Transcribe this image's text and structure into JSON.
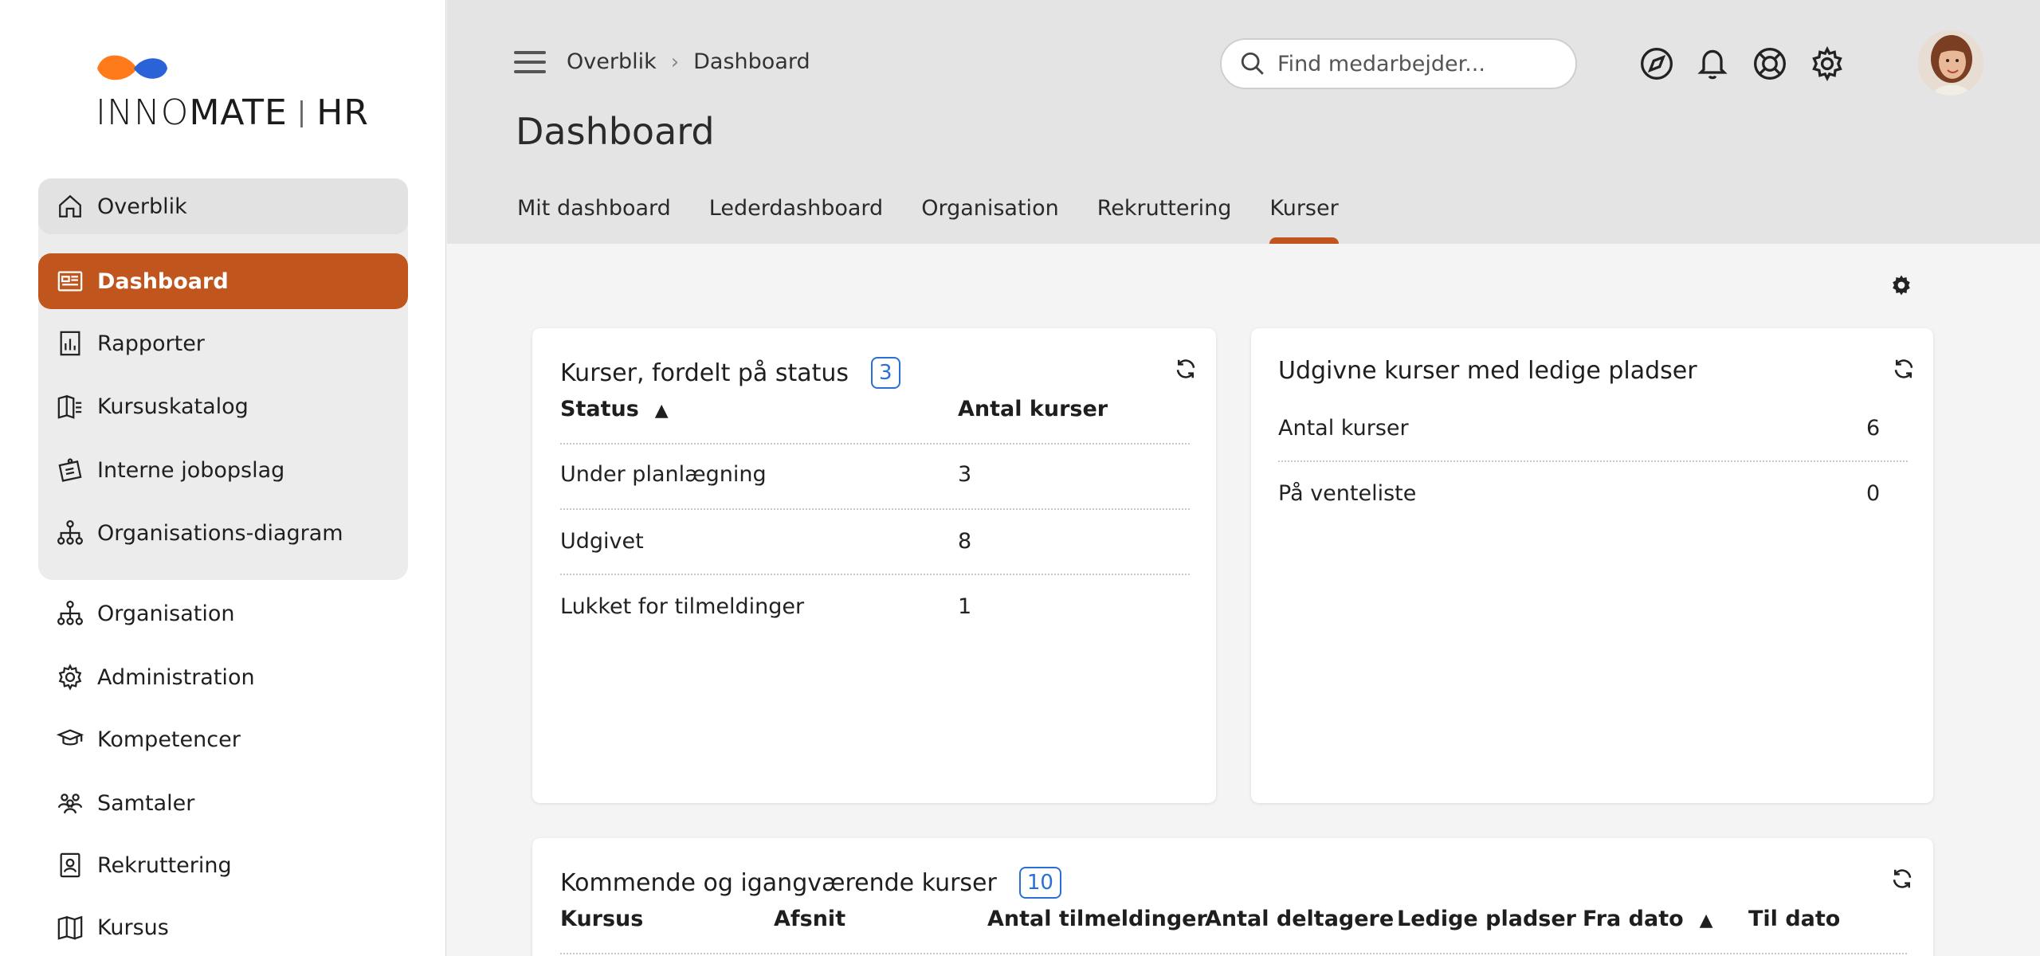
{
  "app": {
    "logo_text_a": "INNO",
    "logo_text_b": "MATE",
    "logo_sep": "|",
    "logo_text_c": "HR",
    "brand_color": "#c0561d",
    "logo_colors": [
      "#ff7a1a",
      "#2a63d8"
    ]
  },
  "sidebar": {
    "group_items": [
      {
        "label": "Overblik",
        "icon": "home-icon"
      },
      {
        "label": "Dashboard",
        "icon": "dashboard-icon",
        "active": true
      },
      {
        "label": "Rapporter",
        "icon": "report-icon"
      },
      {
        "label": "Kursuskatalog",
        "icon": "catalog-icon"
      },
      {
        "label": "Interne jobopslag",
        "icon": "job-posting-icon"
      },
      {
        "label": "Organisations-diagram",
        "icon": "org-chart-icon"
      }
    ],
    "items": [
      {
        "label": "Organisation",
        "icon": "org-chart-icon"
      },
      {
        "label": "Administration",
        "icon": "gear-icon"
      },
      {
        "label": "Kompetencer",
        "icon": "graduation-cap-icon"
      },
      {
        "label": "Samtaler",
        "icon": "people-icon"
      },
      {
        "label": "Rekruttering",
        "icon": "badge-icon"
      },
      {
        "label": "Kursus",
        "icon": "book-icon"
      }
    ]
  },
  "header": {
    "breadcrumb": [
      "Overblik",
      "Dashboard"
    ],
    "title": "Dashboard",
    "search_placeholder": "Find medarbejder...",
    "tabs": [
      {
        "label": "Mit dashboard"
      },
      {
        "label": "Lederdashboard"
      },
      {
        "label": "Organisation"
      },
      {
        "label": "Rekruttering"
      },
      {
        "label": "Kurser",
        "active": true
      }
    ],
    "icons": [
      "navigate-icon",
      "bell-icon",
      "lifebuoy-icon",
      "gear-icon"
    ]
  },
  "cards": {
    "status": {
      "title": "Kurser, fordelt på status",
      "count": "3",
      "col_status": "Status",
      "col_count": "Antal kurser",
      "rows": [
        {
          "status": "Under planlægning",
          "count": "3"
        },
        {
          "status": "Udgivet",
          "count": "8"
        },
        {
          "status": "Lukket for tilmeldinger",
          "count": "1"
        }
      ]
    },
    "published": {
      "title": "Udgivne kurser med ledige pladser",
      "rows": [
        {
          "label": "Antal kurser",
          "value": "6"
        },
        {
          "label": "På venteliste",
          "value": "0"
        }
      ]
    },
    "upcoming": {
      "title": "Kommende og igangværende kurser",
      "count": "10",
      "columns": [
        "Kursus",
        "Afsnit",
        "Antal tilmeldinger",
        "Antal deltagere",
        "Ledige pladser",
        "Fra dato",
        "Til dato"
      ]
    }
  }
}
